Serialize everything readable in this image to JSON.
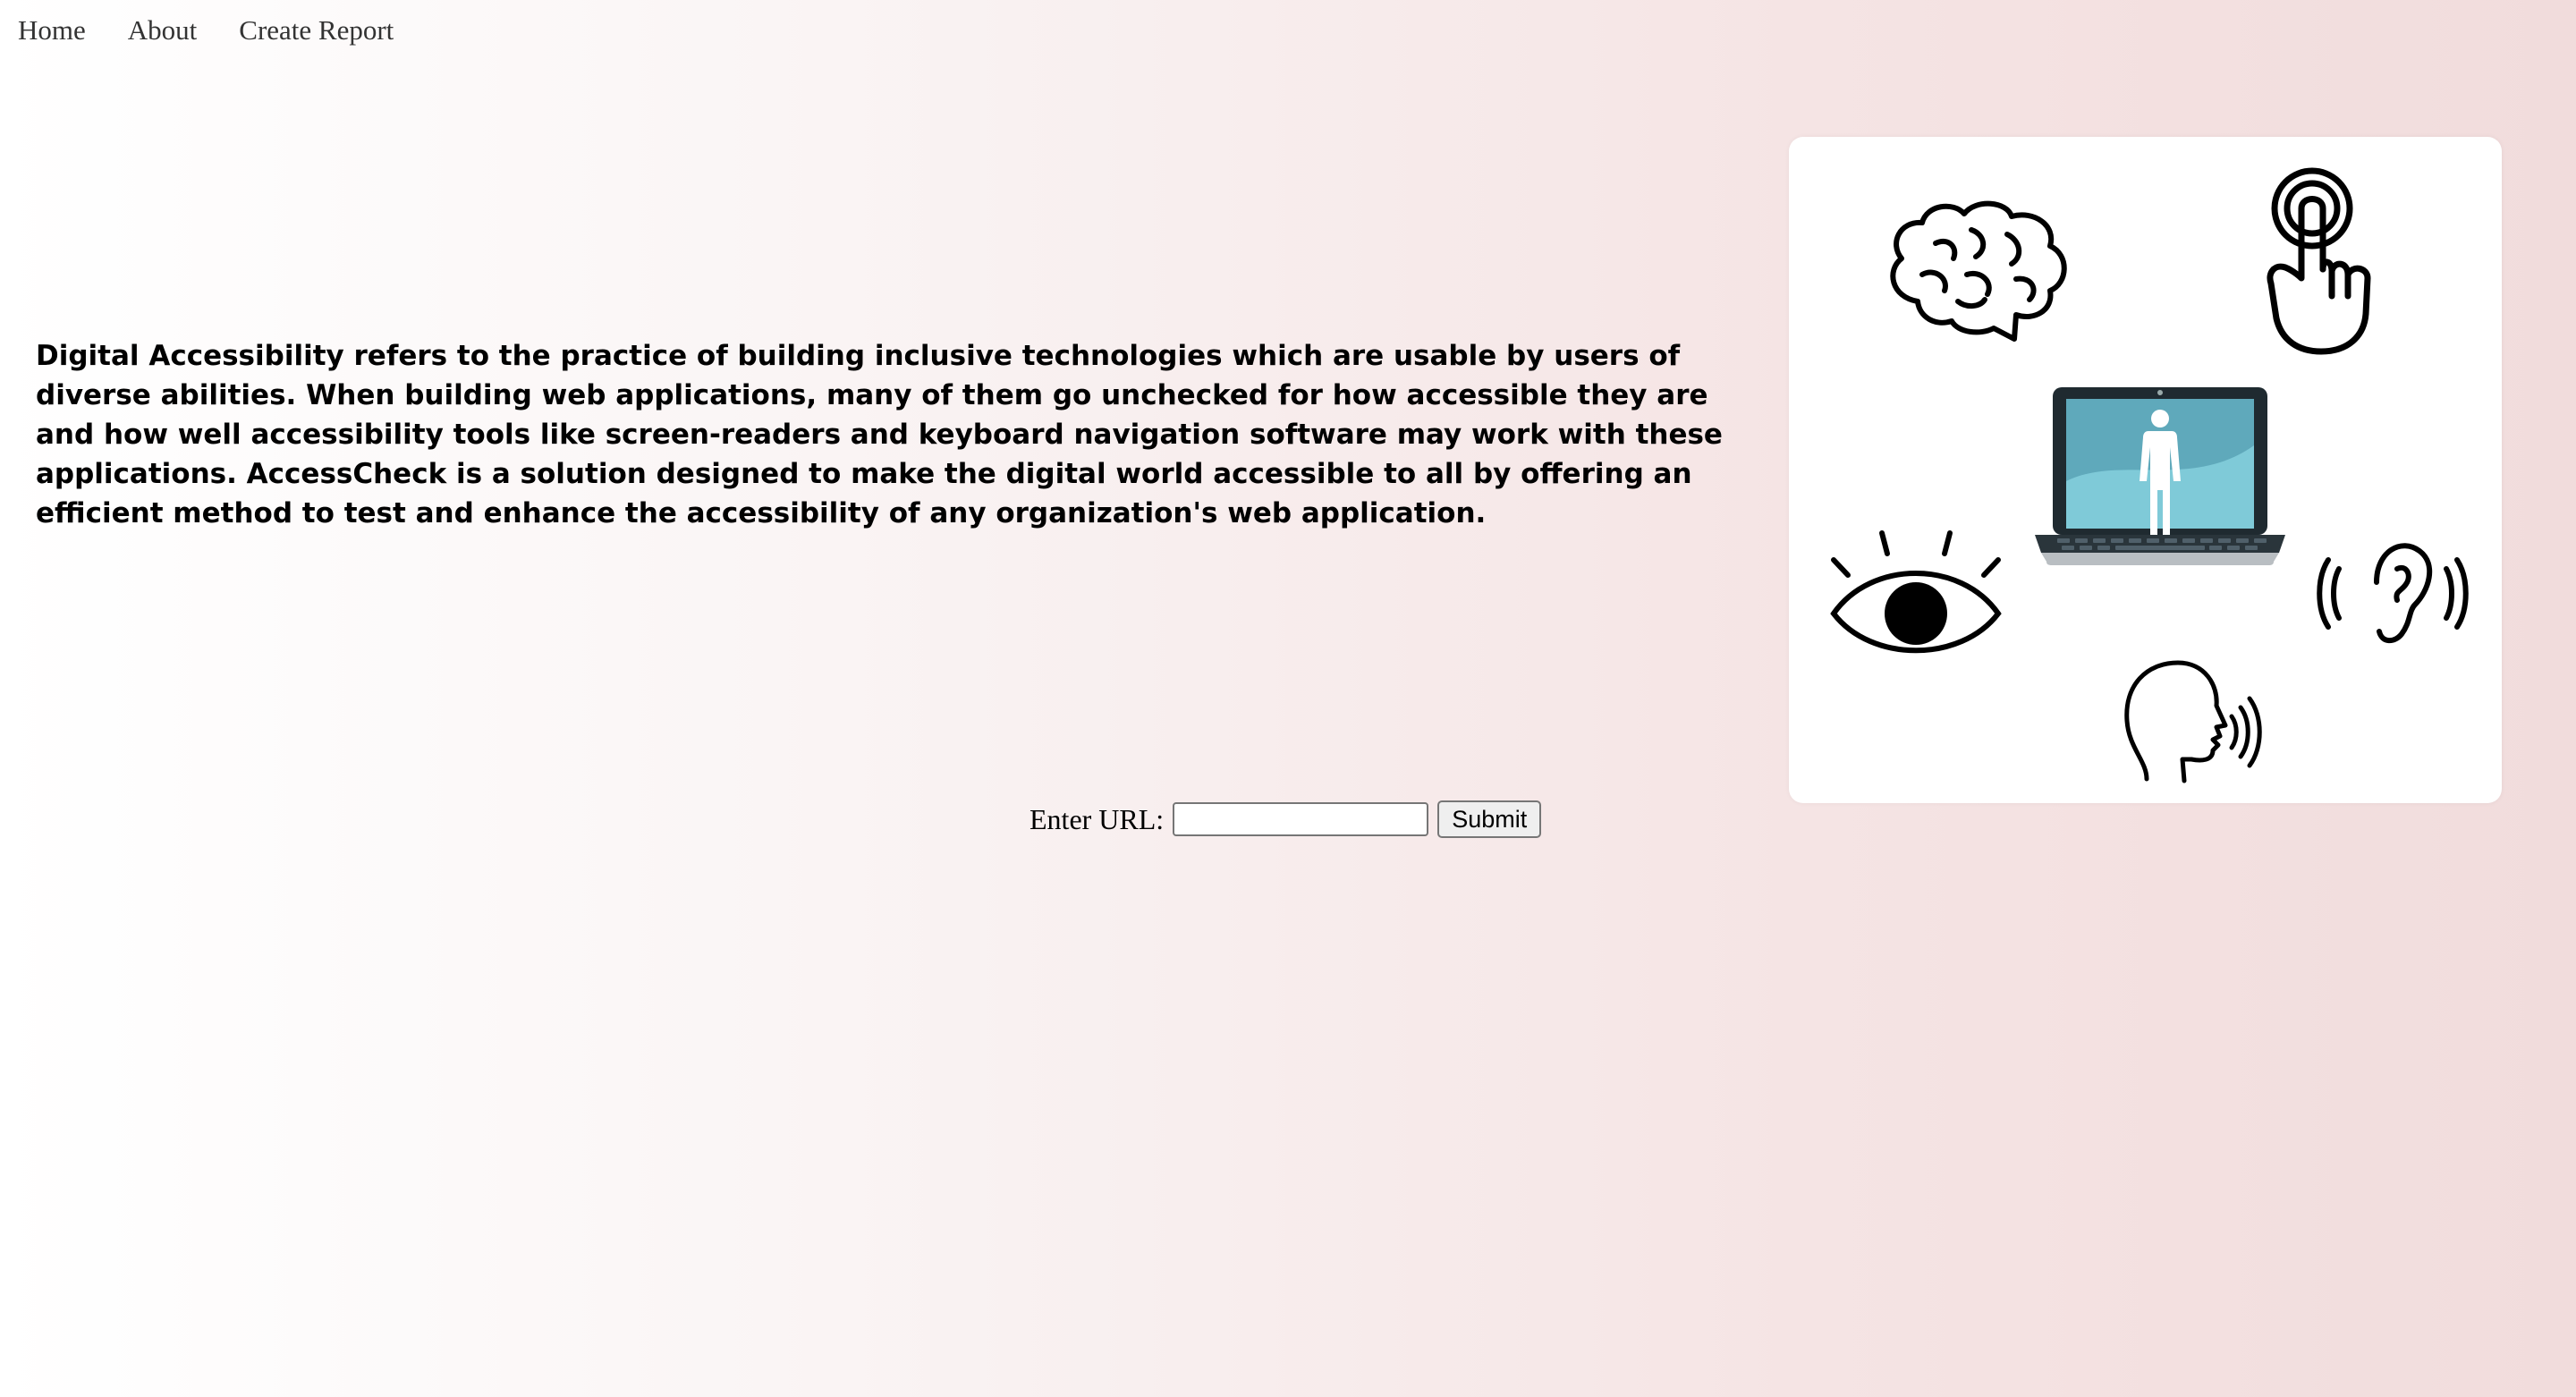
{
  "nav": {
    "home": "Home",
    "about": "About",
    "create_report": "Create Report"
  },
  "intro": {
    "text": "Digital Accessibility refers to the practice of building inclusive technologies which are usable by users of diverse abilities. When building web applications, many of them go unchecked for how accessible they are and how well accessibility tools like screen-readers and keyboard navigation software may work with these applications. AccessCheck is a solution designed to make the digital world accessible to all by offering an efficient method to test and enhance the accessibility of any organization's web application."
  },
  "form": {
    "label": "Enter URL:",
    "input_value": "",
    "submit_label": "Submit"
  },
  "illustration": {
    "icons": [
      "brain-icon",
      "touch-finger-icon",
      "laptop-person-icon",
      "eye-icon",
      "ear-icon",
      "speaking-head-icon"
    ]
  },
  "colors": {
    "screen": "#6fbccd",
    "laptop_frame": "#1f2a30"
  }
}
